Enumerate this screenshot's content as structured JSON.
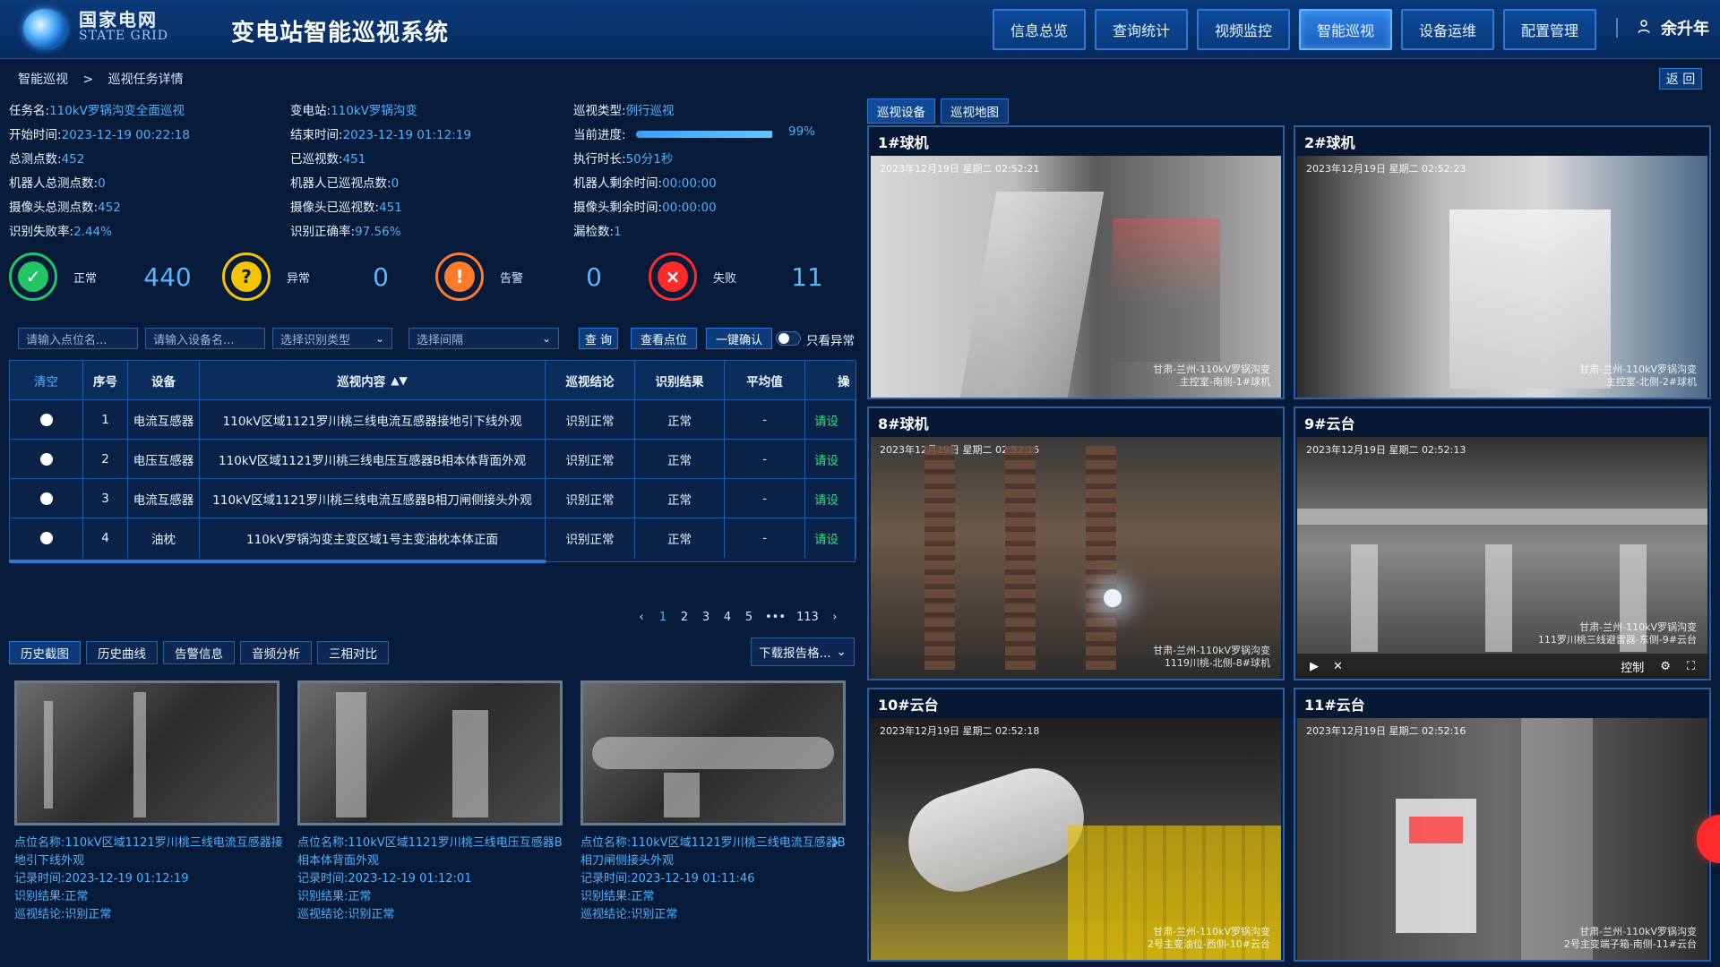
{
  "header": {
    "brand_cn": "国家电网",
    "brand_en": "STATE GRID",
    "app_title": "变电站智能巡视系统",
    "nav": [
      {
        "label": "信息总览"
      },
      {
        "label": "查询统计"
      },
      {
        "label": "视频监控"
      },
      {
        "label": "智能巡视",
        "active": true
      },
      {
        "label": "设备运维"
      },
      {
        "label": "配置管理"
      }
    ],
    "user_name": "余升年"
  },
  "breadcrumb": {
    "parent": "智能巡视",
    "separator": ">",
    "current": "巡视任务详情",
    "back_label": "返 回"
  },
  "task_info": {
    "col1": [
      {
        "k": "任务名:",
        "v": "110kV罗锅沟变全面巡视"
      },
      {
        "k": "开始时间:",
        "v": "2023-12-19 00:22:18"
      },
      {
        "k": "总测点数:",
        "v": "452"
      },
      {
        "k": "机器人总测点数:",
        "v": "0"
      },
      {
        "k": "摄像头总测点数:",
        "v": "452"
      },
      {
        "k": "识别失败率:",
        "v": "2.44%"
      }
    ],
    "col2": [
      {
        "k": "变电站:",
        "v": "110kV罗锅沟变"
      },
      {
        "k": "结束时间:",
        "v": "2023-12-19 01:12:19"
      },
      {
        "k": "已巡视数:",
        "v": "451"
      },
      {
        "k": "机器人已巡视点数:",
        "v": "0"
      },
      {
        "k": "摄像头已巡视数:",
        "v": "451"
      },
      {
        "k": "识别正确率:",
        "v": "97.56%"
      }
    ],
    "col3": [
      {
        "k": "巡视类型:",
        "v": "例行巡视"
      },
      {
        "k": "当前进度:",
        "v": "99%"
      },
      {
        "k": "执行时长:",
        "v": "50分1秒"
      },
      {
        "k": "机器人剩余时间:",
        "v": "00:00:00"
      },
      {
        "k": "摄像头剩余时间:",
        "v": "00:00:00"
      },
      {
        "k": "漏检数:",
        "v": "1"
      }
    ],
    "progress_value": 0.99
  },
  "stats": [
    {
      "label": "正常",
      "value": "440",
      "color": "#23c463",
      "icon": "shield-check-icon"
    },
    {
      "label": "异常",
      "value": "0",
      "color": "#f5c400",
      "icon": "question-icon"
    },
    {
      "label": "告警",
      "value": "0",
      "color": "#ff7a2a",
      "icon": "alarm-bell-icon"
    },
    {
      "label": "失败",
      "value": "11",
      "color": "#ff2a2a",
      "icon": "close-circle-icon"
    }
  ],
  "filters": {
    "point_placeholder": "请输入点位名...",
    "device_placeholder": "请输入设备名...",
    "recognition_type": "选择识别类型",
    "bay": "选择间隔",
    "query_label": "查 询",
    "view_points_label": "查看点位",
    "confirm_all_label": "一键确认",
    "only_abnormal_label": "只看异常"
  },
  "table": {
    "headers": [
      "清空",
      "序号",
      "设备",
      "巡视内容",
      "巡视结论",
      "识别结果",
      "平均值",
      "操作"
    ],
    "sort_icon": "sort-icon",
    "rows": [
      {
        "index": "1",
        "device": "电流互感器",
        "content": "110kV区域1121罗川桃三线电流互感器接地引下线外观",
        "conclusion": "识别正常",
        "result": "正常",
        "avg": "-",
        "op": "请设"
      },
      {
        "index": "2",
        "device": "电压互感器",
        "content": "110kV区域1121罗川桃三线电压互感器B相本体背面外观",
        "conclusion": "识别正常",
        "result": "正常",
        "avg": "-",
        "op": "请设"
      },
      {
        "index": "3",
        "device": "电流互感器",
        "content": "110kV区域1121罗川桃三线电流互感器B相刀闸侧接头外观",
        "conclusion": "识别正常",
        "result": "正常",
        "avg": "-",
        "op": "请设"
      },
      {
        "index": "4",
        "device": "油枕",
        "content": "110kV罗锅沟变主变区域1号主变油枕本体正面",
        "conclusion": "识别正常",
        "result": "正常",
        "avg": "-",
        "op": "请设"
      }
    ]
  },
  "pagination": {
    "prev": "‹",
    "pages": [
      "1",
      "2",
      "3",
      "4",
      "5"
    ],
    "ellipsis": "•••",
    "last": "113",
    "next": "›",
    "current": "1"
  },
  "bottom_tabs": [
    {
      "label": "历史截图",
      "active": true
    },
    {
      "label": "历史曲线"
    },
    {
      "label": "告警信息"
    },
    {
      "label": "音频分析"
    },
    {
      "label": "三相对比"
    }
  ],
  "download_label": "下载报告格...",
  "history": [
    {
      "point_k": "点位名称:",
      "point_v": "110kV区域1121罗川桃三线电流互感器接地引下线外观",
      "time_k": "记录时间:",
      "time_v": "2023-12-19 01:12:19",
      "result_k": "识别结果:",
      "result_v": "正常",
      "conclusion_k": "巡视结论:",
      "conclusion_v": "识别正常"
    },
    {
      "point_k": "点位名称:",
      "point_v": "110kV区域1121罗川桃三线电压互感器B相本体背面外观",
      "time_k": "记录时间:",
      "time_v": "2023-12-19 01:12:01",
      "result_k": "识别结果:",
      "result_v": "正常",
      "conclusion_k": "巡视结论:",
      "conclusion_v": "识别正常"
    },
    {
      "point_k": "点位名称:",
      "point_v": "110kV区域1121罗川桃三线电流互感器B相刀闸侧接头外观",
      "time_k": "记录时间:",
      "time_v": "2023-12-19 01:11:46",
      "result_k": "识别结果:",
      "result_v": "正常",
      "conclusion_k": "巡视结论:",
      "conclusion_v": "识别正常"
    }
  ],
  "right_tabs": [
    {
      "label": "巡视设备",
      "active": true
    },
    {
      "label": "巡视地图"
    }
  ],
  "cameras": [
    {
      "title": "1#球机",
      "timestamp": "2023年12月19日 星期二 02:52:21",
      "watermark": "甘肃-兰州-110kV罗锅沟变\n主控室-南侧-1#球机"
    },
    {
      "title": "2#球机",
      "timestamp": "2023年12月19日 星期二 02:52:23",
      "watermark": "甘肃-兰州-110kV罗锅沟变\n主控室-北侧-2#球机"
    },
    {
      "title": "8#球机",
      "timestamp": "2023年12月19日 星期二 02:52:15",
      "watermark": "甘肃-兰州-110kV罗锅沟变\n1119川桃-北侧-8#球机"
    },
    {
      "title": "9#云台",
      "timestamp": "2023年12月19日 星期二 02:52:13",
      "watermark": "甘肃-兰州-110kV罗锅沟变\n111罗川桃三线避雷器-东侧-9#云台",
      "has_controls": true,
      "control_label": "控制"
    },
    {
      "title": "10#云台",
      "timestamp": "2023年12月19日 星期二 02:52:18",
      "watermark": "甘肃-兰州-110kV罗锅沟变\n2号主变油位-西侧-10#云台"
    },
    {
      "title": "11#云台",
      "timestamp": "2023年12月19日 星期二 02:52:16",
      "watermark": "甘肃-兰州-110kV罗锅沟变\n2号主变端子箱-南侧-11#云台"
    }
  ]
}
